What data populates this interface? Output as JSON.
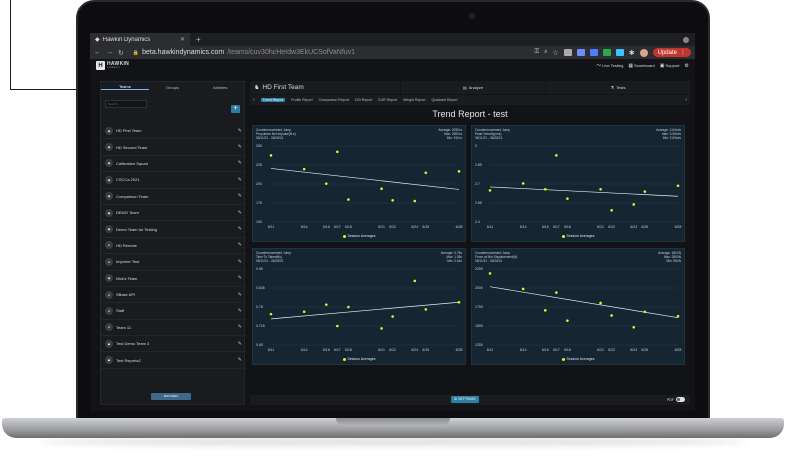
{
  "browser": {
    "tab_title": "Hawkin Dynamics",
    "url_host": "beta.hawkindynamics.com",
    "url_path": "/teams/cuv30hcHeIdw3EkUCSofVaNfuv1",
    "update_label": "Update"
  },
  "app_header": {
    "logo_text": "HAWKIN",
    "logo_sub": "DYNAMICS",
    "links": [
      "Live Testing",
      "Scoreboard",
      "Support"
    ]
  },
  "left_panel": {
    "tabs": [
      "Teams",
      "Groups",
      "Athletes"
    ],
    "search_placeholder": "Search...",
    "teams": [
      {
        "name": "HD First Team",
        "icon": "team-logo"
      },
      {
        "name": "HD Second Team",
        "icon": "team-logo"
      },
      {
        "name": "Calibration Squad",
        "icon": "team-logo"
      },
      {
        "name": "CSCCa 2021",
        "icon": "team-logo"
      },
      {
        "name": "Comparison Team",
        "icon": "team-logo"
      },
      {
        "name": "DEMO Team",
        "icon": "team-logo"
      },
      {
        "name": "Demo Team for Testing",
        "icon": "team-logo"
      },
      {
        "name": "HD Remote",
        "icon": "person-icon"
      },
      {
        "name": "Importer Test",
        "icon": "person-icon"
      },
      {
        "name": "Nick's Team",
        "icon": "team-logo"
      },
      {
        "name": "SBase API",
        "icon": "person-icon"
      },
      {
        "name": "Staff",
        "icon": "person-icon"
      },
      {
        "name": "Team 11",
        "icon": "person-icon"
      },
      {
        "name": "Test Demo Team 3",
        "icon": "team-logo"
      },
      {
        "name": "Test Reports2",
        "icon": "team-logo"
      }
    ],
    "roster_label": "ROSTERS"
  },
  "right": {
    "team_title": "HD First Team",
    "top_tabs": [
      "Analyze",
      "Tests"
    ],
    "report_tabs": [
      "Trend Report",
      "Profile Report",
      "Comparison Report",
      "DSI Report",
      "EUR Report",
      "Weight Report",
      "Quadrant Report"
    ],
    "page_title": "Trend Report - test",
    "settings_label": "SETTINGS",
    "pdf_label": "PDF"
  },
  "chart_data": [
    {
      "type": "scatter",
      "test": "Countermovement Jump",
      "metric": "Propulsive Net Impulse(N.s)",
      "range": "06/11/21 - 06/28/21",
      "stats": [
        "Average: 209N.s",
        "Max: 250N.s",
        "Min: 91N.s"
      ],
      "yticks": [
        "250",
        "225",
        "200",
        "175",
        "150"
      ],
      "xticks": [
        "6/11",
        "6/14",
        "6/16",
        "6/17",
        "6/18",
        "6/21",
        "6/22",
        "6/24",
        "6/25",
        "6/28"
      ],
      "ylim": [
        150,
        255
      ],
      "x": [
        0,
        3,
        5,
        6,
        7,
        10,
        11,
        13,
        14,
        17
      ],
      "y": [
        242,
        223,
        203,
        247,
        181,
        196,
        180,
        179,
        218,
        220
      ],
      "trend": [
        224,
        195
      ],
      "legend": "Session Averages"
    },
    {
      "type": "scatter",
      "test": "Countermovement Jump",
      "metric": "Peak Velocity(m/s)",
      "range": "06/11/21 - 06/28/21",
      "stats": [
        "Average: 2.64m/s",
        "Max: 3.08m/s",
        "Min: 2.53m/s"
      ],
      "yticks": [
        "3",
        "2.85",
        "2.7",
        "2.55",
        "2.4"
      ],
      "xticks": [
        "6/11",
        "6/14",
        "6/16",
        "6/17",
        "6/18",
        "6/21",
        "6/22",
        "6/24",
        "6/25",
        "6/28"
      ],
      "ylim": [
        2.4,
        3.05
      ],
      "x": [
        0,
        3,
        5,
        6,
        7,
        10,
        11,
        13,
        14,
        17
      ],
      "y": [
        2.67,
        2.73,
        2.68,
        2.97,
        2.6,
        2.68,
        2.5,
        2.55,
        2.66,
        2.71
      ],
      "trend": [
        2.7,
        2.62
      ],
      "legend": "Session Averages"
    },
    {
      "type": "scatter",
      "test": "Countermovement Jump",
      "metric": "Time To Takeoff(s)",
      "range": "06/11/21 - 06/28/21",
      "stats": [
        "Average: 0.75s",
        "Max: 1.05s",
        "Min: 0.61s"
      ],
      "yticks": [
        "0.95",
        "0.845",
        "0.78",
        "0.715",
        "0.65"
      ],
      "xticks": [
        "6/11",
        "6/14",
        "6/16",
        "6/17",
        "6/18",
        "6/21",
        "6/22",
        "6/24",
        "6/25",
        "6/28"
      ],
      "ylim": [
        0.65,
        0.97
      ],
      "x": [
        0,
        3,
        5,
        6,
        7,
        10,
        11,
        13,
        14,
        17
      ],
      "y": [
        0.78,
        0.79,
        0.82,
        0.73,
        0.81,
        0.72,
        0.77,
        0.92,
        0.8,
        0.83
      ],
      "trend": [
        0.76,
        0.83
      ],
      "legend": "Session Averages"
    },
    {
      "type": "scatter",
      "test": "Countermovement Jump",
      "metric": "Force at Min Displacement(N)",
      "range": "06/11/21 - 06/28/21",
      "stats": [
        "Average: 1802N",
        "Max: 2800N",
        "Min: 984N"
      ],
      "yticks": [
        "2250",
        "2000",
        "1750",
        "1500",
        "1250"
      ],
      "xticks": [
        "6/11",
        "6/14",
        "6/16",
        "6/17",
        "6/18",
        "6/21",
        "6/22",
        "6/24",
        "6/25",
        "6/28"
      ],
      "ylim": [
        1250,
        2280
      ],
      "x": [
        0,
        3,
        5,
        6,
        7,
        10,
        11,
        13,
        14,
        17
      ],
      "y": [
        2220,
        2010,
        1720,
        1960,
        1580,
        1820,
        1650,
        1490,
        1700,
        1640
      ],
      "trend": [
        2040,
        1620
      ],
      "legend": "Session Averages"
    }
  ]
}
